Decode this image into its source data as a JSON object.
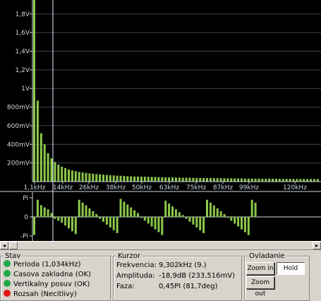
{
  "spectrum": {
    "y_ticks": [
      "1,8V",
      "1,6V",
      "1,4V",
      "1,2V",
      "1V",
      "800mV",
      "600mV",
      "400mV",
      "200mV"
    ],
    "x_ticks": [
      "1,1kHz",
      "14kHz",
      "26kHz",
      "38kHz",
      "50kHz",
      "63kHz",
      "75kHz",
      "87kHz",
      "99kHz",
      "120kHz"
    ],
    "bar_color": "#8cc84b",
    "cursor_color": "#e8f0ff",
    "grid_color": "#3c4a56",
    "phase_ticks": [
      "Pi",
      "0",
      "-Pi"
    ]
  },
  "chart_data": [
    {
      "type": "bar",
      "title": "",
      "xlabel": "",
      "ylabel": "",
      "x_tick_labels": [
        "1,1kHz",
        "14kHz",
        "26kHz",
        "38kHz",
        "50kHz",
        "63kHz",
        "75kHz",
        "87kHz",
        "99kHz",
        "120kHz"
      ],
      "y_tick_labels": [
        "200mV",
        "400mV",
        "600mV",
        "800mV",
        "1V",
        "1,2V",
        "1,4V",
        "1,6V",
        "1,8V"
      ],
      "ylim_mV": [
        0,
        1950
      ],
      "harmonic_spacing_kHz": 1.034,
      "values_mV": [
        1950,
        870,
        520,
        400,
        305,
        250,
        210,
        182,
        160,
        145,
        130,
        120,
        112,
        104,
        98,
        93,
        88,
        84,
        80,
        77,
        74,
        71,
        68,
        66,
        64,
        62,
        60,
        58,
        56,
        55,
        54,
        53,
        52,
        51,
        50,
        49,
        48,
        47,
        46,
        45,
        44,
        44,
        43,
        42,
        42,
        41,
        40,
        40,
        39,
        39,
        38,
        38,
        37,
        37,
        36,
        36,
        35,
        35,
        34,
        34,
        34,
        33,
        33,
        32,
        32,
        32,
        31,
        31,
        31,
        30,
        30,
        30,
        29,
        29,
        29,
        28,
        28,
        28,
        28,
        27,
        27,
        27,
        27,
        26,
        26,
        26
      ],
      "grid": true
    },
    {
      "type": "bar",
      "title": "",
      "y_tick_labels": [
        "Pi",
        "0",
        "-Pi"
      ],
      "ylim_pi": [
        -1,
        1
      ],
      "values_pi": [
        -0.95,
        0.9,
        0.62,
        0.5,
        0.4,
        0.2,
        -0.1,
        -0.2,
        -0.3,
        -0.45,
        -0.6,
        -0.75,
        -0.9,
        0.9,
        0.75,
        0.6,
        0.45,
        0.3,
        0.15,
        -0.1,
        -0.25,
        -0.4,
        -0.55,
        -0.7,
        -0.85,
        0.95,
        0.8,
        0.65,
        0.5,
        0.35,
        0.2,
        -0.05,
        -0.2,
        -0.35,
        -0.5,
        -0.65,
        -0.8,
        -0.95,
        0.85,
        0.7,
        0.55,
        0.4,
        0.25,
        0.1,
        -0.1,
        -0.25,
        -0.4,
        -0.55,
        -0.7,
        -0.85,
        0.9,
        0.75,
        0.6,
        0.45,
        0.3,
        0.15,
        -0.05,
        -0.2,
        -0.35,
        -0.5,
        -0.65,
        -0.8,
        -0.95,
        0.9,
        0.75
      ],
      "grid": false
    }
  ],
  "scrollbar": {
    "left_arrow": "◂",
    "right_arrow": "▸"
  },
  "stav": {
    "title": "Stav",
    "items": [
      {
        "label": "Perioda (1,034kHz)",
        "color": "#21a84a"
      },
      {
        "label": "Casova zakladna (OK)",
        "color": "#21a84a"
      },
      {
        "label": "Vertikalny posuv (OK)",
        "color": "#21a84a"
      },
      {
        "label": "Rozsah (Necitlivy)",
        "color": "#e01616"
      }
    ]
  },
  "kurzor": {
    "title": "Kurzor",
    "rows": [
      {
        "label": "Frekvencia:",
        "value": "9,302kHz (9.)"
      },
      {
        "label": "Amplituda:",
        "value": "-18,9dB (233,516mV)"
      },
      {
        "label": "Faza:",
        "value": "0,45PI (81,7deg)"
      }
    ]
  },
  "ovladanie": {
    "title": "Ovladanie",
    "zoom_in": "Zoom in",
    "zoom_out": "Zoom out",
    "hold": "Hold"
  }
}
